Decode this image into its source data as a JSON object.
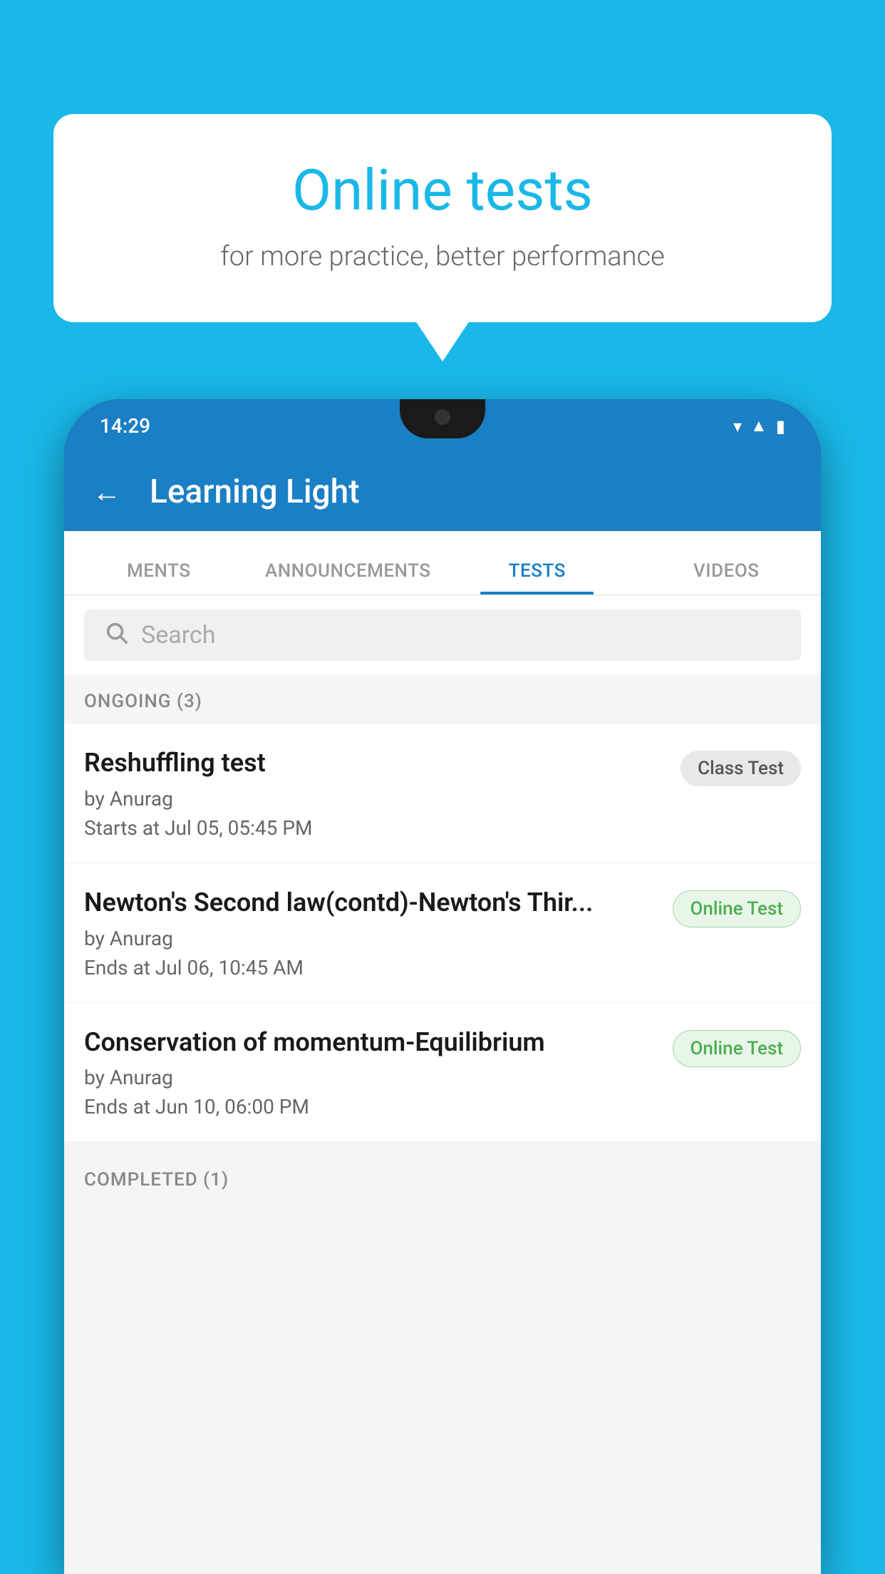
{
  "background_color": "#1ab8e8",
  "speech_bubble": {
    "title": "Online tests",
    "subtitle": "for more practice, better performance"
  },
  "status_bar": {
    "time": "14:29",
    "icons": [
      "wifi",
      "signal",
      "battery"
    ]
  },
  "app_bar": {
    "title": "Learning Light",
    "back_label": "←"
  },
  "tabs": [
    {
      "label": "MENTS",
      "active": false
    },
    {
      "label": "ANNOUNCEMENTS",
      "active": false
    },
    {
      "label": "TESTS",
      "active": true
    },
    {
      "label": "VIDEOS",
      "active": false
    }
  ],
  "search": {
    "placeholder": "Search"
  },
  "sections": [
    {
      "header": "ONGOING (3)",
      "items": [
        {
          "title": "Reshuffling test",
          "author": "by Anurag",
          "time": "Starts at  Jul 05, 05:45 PM",
          "badge": "Class Test",
          "badge_type": "class"
        },
        {
          "title": "Newton's Second law(contd)-Newton's Thir...",
          "author": "by Anurag",
          "time": "Ends at  Jul 06, 10:45 AM",
          "badge": "Online Test",
          "badge_type": "online"
        },
        {
          "title": "Conservation of momentum-Equilibrium",
          "author": "by Anurag",
          "time": "Ends at  Jun 10, 06:00 PM",
          "badge": "Online Test",
          "badge_type": "online"
        }
      ]
    },
    {
      "header": "COMPLETED (1)",
      "items": []
    }
  ]
}
